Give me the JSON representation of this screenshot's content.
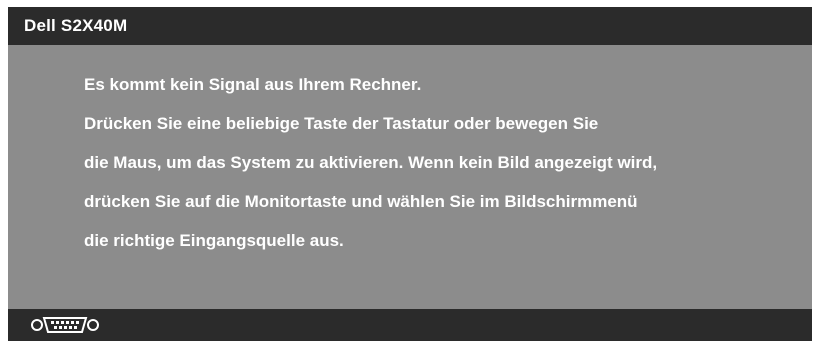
{
  "window": {
    "title": "Dell S2X40M"
  },
  "message": {
    "lines": [
      "Es kommt kein Signal aus Ihrem Rechner.",
      "Drücken Sie eine beliebige Taste der Tastatur oder bewegen Sie",
      "die Maus, um das System zu aktivieren. Wenn kein Bild angezeigt wird,",
      "drücken Sie auf die Monitortaste und wählen Sie im Bildschirmmenü",
      "die richtige Eingangsquelle aus."
    ]
  },
  "status_bar": {
    "input_icon": "vga-connector-icon"
  },
  "colors": {
    "title_bar": "#2b2b2b",
    "message_background": "#8c8c8c",
    "text": "#ffffff"
  }
}
